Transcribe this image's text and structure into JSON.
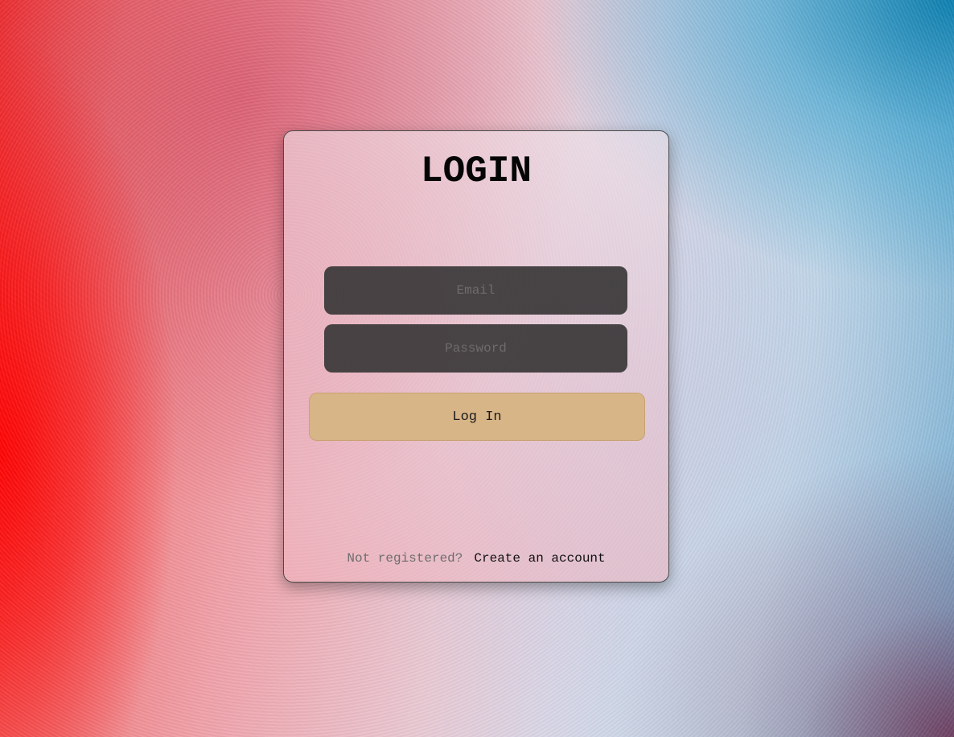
{
  "login_form": {
    "title": "LOGIN",
    "email_placeholder": "Email",
    "password_placeholder": "Password",
    "submit_label": "Log In",
    "footer_text": "Not registered?",
    "create_account_link": "Create an account"
  },
  "colors": {
    "field_background": "#3a3738",
    "button_background": "#d8b587",
    "title_color": "#050505"
  }
}
